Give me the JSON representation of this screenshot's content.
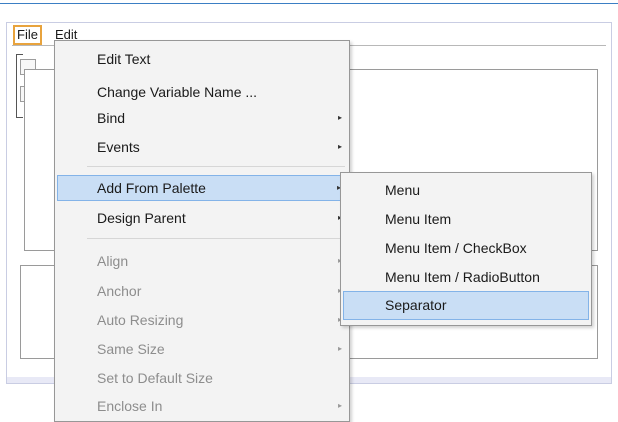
{
  "menubar": {
    "file_label": "File",
    "edit_label": "Edit"
  },
  "context_menu": {
    "items": [
      {
        "label": "Edit Text",
        "has_submenu": false,
        "enabled": true
      },
      {
        "label": "Change Variable Name ...",
        "has_submenu": false,
        "enabled": true
      },
      {
        "label": "Bind",
        "has_submenu": true,
        "enabled": true
      },
      {
        "label": "Events",
        "has_submenu": true,
        "enabled": true
      },
      {
        "label": "Add From Palette",
        "has_submenu": true,
        "enabled": true,
        "highlighted": true
      },
      {
        "label": "Design Parent",
        "has_submenu": true,
        "enabled": true
      },
      {
        "label": "Align",
        "has_submenu": true,
        "enabled": false
      },
      {
        "label": "Anchor",
        "has_submenu": true,
        "enabled": false
      },
      {
        "label": "Auto Resizing",
        "has_submenu": true,
        "enabled": false
      },
      {
        "label": "Same Size",
        "has_submenu": true,
        "enabled": false
      },
      {
        "label": "Set to Default Size",
        "has_submenu": false,
        "enabled": false
      },
      {
        "label": "Enclose In",
        "has_submenu": true,
        "enabled": false
      }
    ]
  },
  "submenu": {
    "items": [
      {
        "label": "Menu"
      },
      {
        "label": "Menu Item"
      },
      {
        "label": "Menu Item / CheckBox"
      },
      {
        "label": "Menu Item / RadioButton"
      },
      {
        "label": "Separator",
        "highlighted": true
      }
    ]
  },
  "icons": {
    "submenu_arrow": "▸"
  },
  "colors": {
    "highlight_bg": "#c9def5",
    "highlight_border": "#83b3e8",
    "focus_outline": "#e8a33d"
  }
}
